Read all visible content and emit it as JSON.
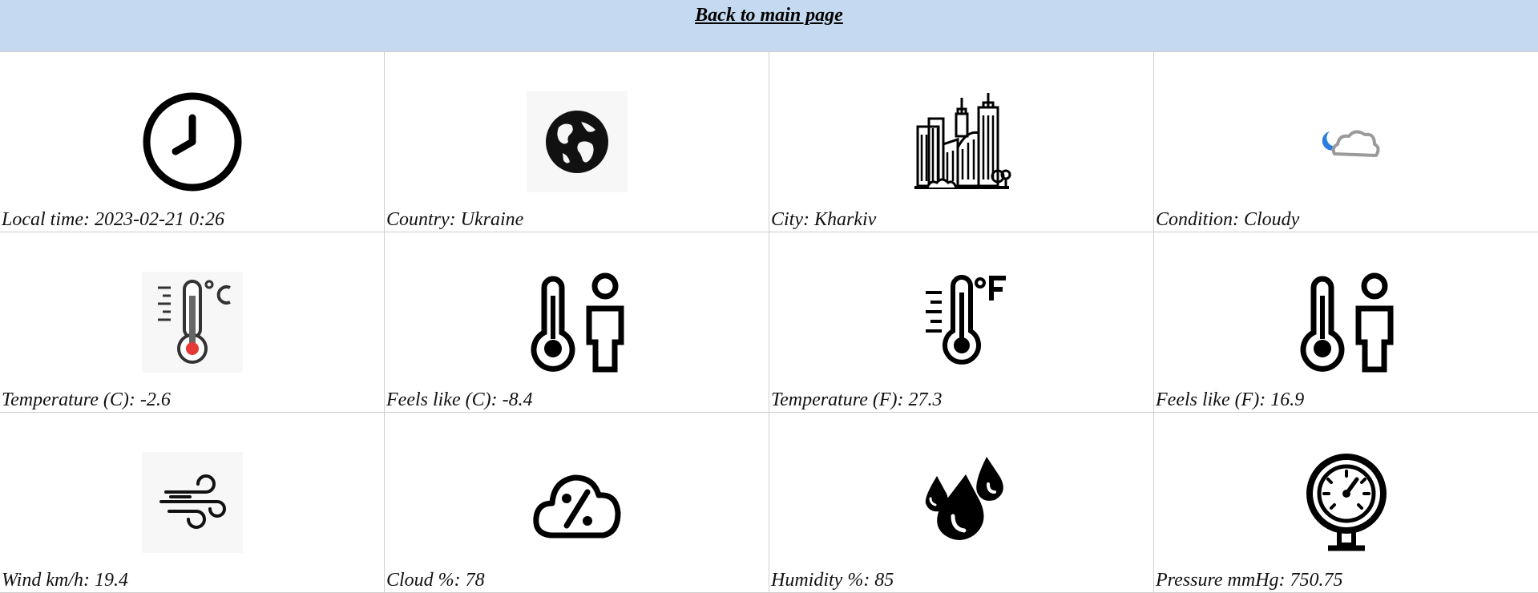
{
  "header": {
    "back_link": "Back to main page"
  },
  "cells": [
    {
      "label": "Local time: 2023-02-21 0:26",
      "icon": "clock-icon"
    },
    {
      "label": "Country: Ukraine",
      "icon": "globe-icon"
    },
    {
      "label": "City: Kharkiv",
      "icon": "city-icon"
    },
    {
      "label": "Condition: Cloudy",
      "icon": "partly-cloudy-night-icon"
    },
    {
      "label": "Temperature (C): -2.6",
      "icon": "thermometer-celsius-icon"
    },
    {
      "label": "Feels like (C): -8.4",
      "icon": "feels-like-icon"
    },
    {
      "label": "Temperature (F): 27.3",
      "icon": "thermometer-fahrenheit-icon"
    },
    {
      "label": "Feels like (F): 16.9",
      "icon": "feels-like-icon"
    },
    {
      "label": "Wind km/h: 19.4",
      "icon": "wind-icon"
    },
    {
      "label": "Cloud %: 78",
      "icon": "cloud-percent-icon"
    },
    {
      "label": "Humidity %: 85",
      "icon": "humidity-drops-icon"
    },
    {
      "label": "Pressure mmHg: 750.75",
      "icon": "pressure-gauge-icon"
    }
  ],
  "colors": {
    "header_bg": "#c5d9f0",
    "grid_border": "#cfcfcf",
    "thermo_red": "#e53935",
    "moon_blue": "#2a7de1"
  }
}
